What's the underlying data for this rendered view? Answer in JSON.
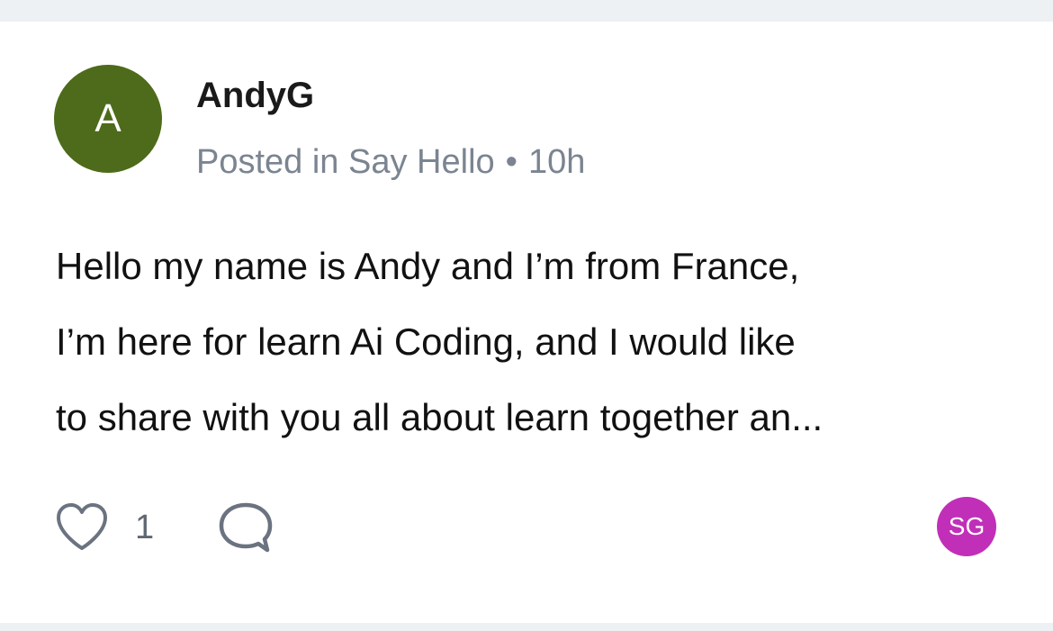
{
  "post": {
    "author": {
      "initial": "A",
      "name": "AndyG",
      "avatar_color": "#4d6b1a"
    },
    "meta": {
      "prefix": "Posted in",
      "space": "Say Hello",
      "separator": "•",
      "time": "10h"
    },
    "body_lines": [
      "Hello my name is Andy and I’m from France,",
      "I’m here for learn Ai Coding, and I would like",
      "to share with you all about learn together an..."
    ],
    "actions": {
      "like_icon": "heart-icon",
      "like_count": "1",
      "comment_icon": "comment-bubble-icon"
    },
    "participants": [
      {
        "initials": "SG",
        "color": "#c12fb8"
      }
    ]
  },
  "colors": {
    "card_background": "#ffffff",
    "page_background": "#eef1f4",
    "meta_text": "#7b8491",
    "icon": "#6b7380"
  }
}
